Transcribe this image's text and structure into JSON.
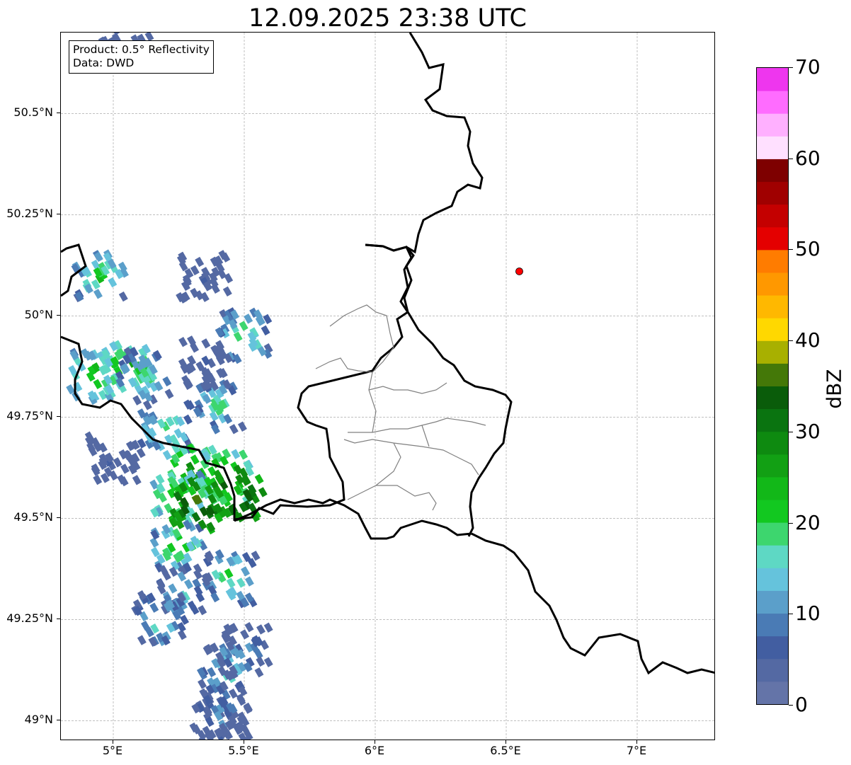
{
  "title": "12.09.2025 23:38 UTC",
  "info": {
    "product": "Product: 0.5° Reflectivity",
    "data": "Data: DWD"
  },
  "map": {
    "lon_range": [
      4.8,
      7.3
    ],
    "lat_range": [
      48.95,
      50.7
    ],
    "x_ticks": [
      {
        "value": 5.0,
        "label": "5°E"
      },
      {
        "value": 5.5,
        "label": "5.5°E"
      },
      {
        "value": 6.0,
        "label": "6°E"
      },
      {
        "value": 6.5,
        "label": "6.5°E"
      },
      {
        "value": 7.0,
        "label": "7°E"
      }
    ],
    "y_ticks": [
      {
        "value": 50.5,
        "label": "50.5°N"
      },
      {
        "value": 50.25,
        "label": "50.25°N"
      },
      {
        "value": 50.0,
        "label": "50°N"
      },
      {
        "value": 49.75,
        "label": "49.75°N"
      },
      {
        "value": 49.5,
        "label": "49.5°N"
      },
      {
        "value": 49.25,
        "label": "49.25°N"
      },
      {
        "value": 49.0,
        "label": "49°N"
      }
    ],
    "grid": true,
    "radar_site": {
      "lon": 6.55,
      "lat": 50.11,
      "color": "#ff0000"
    },
    "reflectivity_cells": [
      {
        "lon": 4.95,
        "lat": 50.1,
        "dbz": 25
      },
      {
        "lon": 4.93,
        "lat": 49.85,
        "dbz": 28
      },
      {
        "lon": 5.05,
        "lat": 49.87,
        "dbz": 30
      },
      {
        "lon": 5.12,
        "lat": 49.85,
        "dbz": 22
      },
      {
        "lon": 5.2,
        "lat": 49.72,
        "dbz": 24
      },
      {
        "lon": 5.3,
        "lat": 49.62,
        "dbz": 32
      },
      {
        "lon": 5.25,
        "lat": 49.55,
        "dbz": 30
      },
      {
        "lon": 5.25,
        "lat": 49.43,
        "dbz": 26
      },
      {
        "lon": 5.43,
        "lat": 49.6,
        "dbz": 33
      },
      {
        "lon": 5.48,
        "lat": 49.56,
        "dbz": 42
      },
      {
        "lon": 5.32,
        "lat": 49.53,
        "dbz": 42
      },
      {
        "lon": 5.5,
        "lat": 49.95,
        "dbz": 24
      },
      {
        "lon": 5.4,
        "lat": 49.78,
        "dbz": 22
      },
      {
        "lon": 5.45,
        "lat": 49.35,
        "dbz": 24
      },
      {
        "lon": 5.27,
        "lat": 49.32,
        "dbz": 20
      },
      {
        "lon": 5.18,
        "lat": 49.25,
        "dbz": 22
      },
      {
        "lon": 5.43,
        "lat": 49.12,
        "dbz": 22
      },
      {
        "lon": 5.5,
        "lat": 49.17,
        "dbz": 16
      },
      {
        "lon": 5.43,
        "lat": 49.0,
        "dbz": 14
      },
      {
        "lon": 5.4,
        "lat": 49.03,
        "dbz": 16
      },
      {
        "lon": 5.35,
        "lat": 50.1,
        "dbz": 10
      },
      {
        "lon": 5.0,
        "lat": 49.65,
        "dbz": 10
      },
      {
        "lon": 5.35,
        "lat": 49.88,
        "dbz": 8
      },
      {
        "lon": 5.05,
        "lat": 50.66,
        "dbz": 6
      }
    ]
  },
  "colorbar": {
    "label": "dBZ",
    "min": 0,
    "max": 70,
    "ticks": [
      {
        "value": 0,
        "label": "0"
      },
      {
        "value": 10,
        "label": "10"
      },
      {
        "value": 20,
        "label": "20"
      },
      {
        "value": 30,
        "label": "30"
      },
      {
        "value": 40,
        "label": "40"
      },
      {
        "value": 50,
        "label": "50"
      },
      {
        "value": 60,
        "label": "60"
      },
      {
        "value": 70,
        "label": "70"
      }
    ],
    "colors": [
      "#6474a8",
      "#5469a3",
      "#425ea1",
      "#4a7bb5",
      "#5b9fca",
      "#65c3dc",
      "#5ed8c4",
      "#3dd66e",
      "#12c820",
      "#12b818",
      "#12a014",
      "#0e8a10",
      "#0a7410",
      "#0a5c0a",
      "#447808",
      "#a8b000",
      "#ffd800",
      "#ffb800",
      "#ff9800",
      "#ff7c00",
      "#e40000",
      "#c40000",
      "#a00000",
      "#7e0000",
      "#ffe0ff",
      "#ffb0ff",
      "#ff6cff",
      "#ee36ee"
    ]
  }
}
